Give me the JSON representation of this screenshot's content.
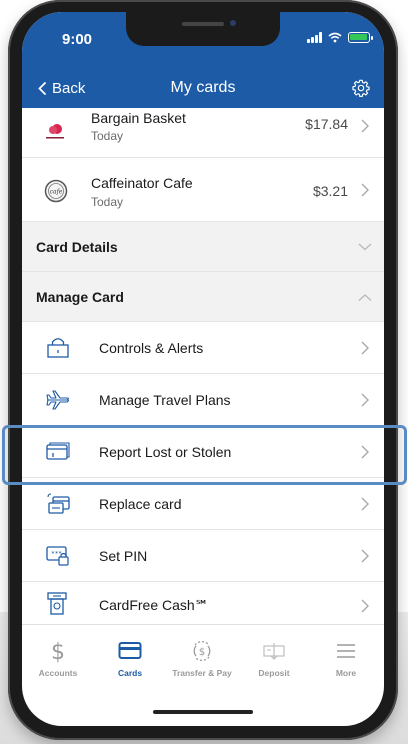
{
  "status_bar": {
    "time": "9:00"
  },
  "nav": {
    "back_label": "Back",
    "title": "My cards"
  },
  "transactions": [
    {
      "merchant": "Bargain Basket",
      "date": "Today",
      "amount": "$17.84"
    },
    {
      "merchant": "Caffeinator Cafe",
      "date": "Today",
      "amount": "$3.21"
    }
  ],
  "sections": {
    "card_details": "Card Details",
    "manage_card": "Manage Card"
  },
  "manage_items": [
    {
      "label": "Controls & Alerts",
      "icon": "lock-icon"
    },
    {
      "label": "Manage Travel Plans",
      "icon": "airplane-icon"
    },
    {
      "label": "Report Lost or Stolen",
      "icon": "card-icon"
    },
    {
      "label": "Replace card",
      "icon": "replace-card-icon"
    },
    {
      "label": "Set PIN",
      "icon": "pin-icon"
    },
    {
      "label": "CardFree Cash℠",
      "icon": "cash-icon"
    }
  ],
  "tabs": [
    {
      "label": "Accounts",
      "icon": "dollar-icon",
      "active": false
    },
    {
      "label": "Cards",
      "icon": "card-icon",
      "active": true
    },
    {
      "label": "Transfer & Pay",
      "icon": "transfer-icon",
      "active": false
    },
    {
      "label": "Deposit",
      "icon": "deposit-icon",
      "active": false
    },
    {
      "label": "More",
      "icon": "menu-icon",
      "active": false
    }
  ],
  "colors": {
    "brand_blue": "#1d5ba6",
    "highlight": "#5a8cc4",
    "battery_green": "#34c759"
  }
}
